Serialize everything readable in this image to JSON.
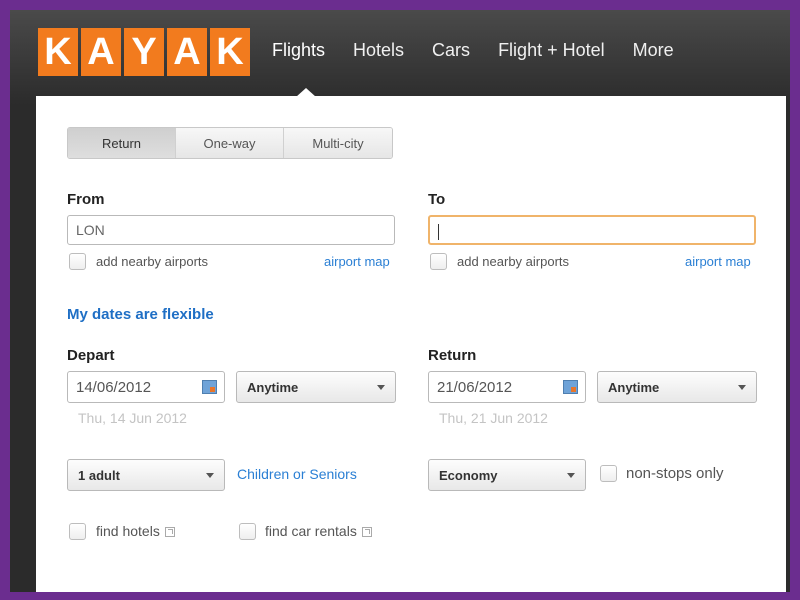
{
  "logo": {
    "letters": [
      "K",
      "A",
      "Y",
      "A",
      "K"
    ]
  },
  "nav": {
    "items": [
      "Flights",
      "Hotels",
      "Cars",
      "Flight + Hotel",
      "More"
    ],
    "active": "Flights"
  },
  "trip_type": {
    "options": [
      "Return",
      "One-way",
      "Multi-city"
    ],
    "selected": "Return"
  },
  "from": {
    "label": "From",
    "value": "LON",
    "nearby_label": "add nearby airports",
    "map_link": "airport map"
  },
  "to": {
    "label": "To",
    "value": "",
    "nearby_label": "add nearby airports",
    "map_link": "airport map"
  },
  "flexible_link": "My dates are flexible",
  "depart": {
    "label": "Depart",
    "date": "14/06/2012",
    "time": "Anytime",
    "hint": "Thu, 14 Jun 2012"
  },
  "return": {
    "label": "Return",
    "date": "21/06/2012",
    "time": "Anytime",
    "hint": "Thu, 21 Jun 2012"
  },
  "passengers": {
    "value": "1 adult",
    "link": "Children or Seniors"
  },
  "cabin": {
    "value": "Economy"
  },
  "nonstop": {
    "label": "non-stops only"
  },
  "extras": {
    "hotels": "find hotels",
    "cars": "find car rentals"
  },
  "colors": {
    "brand_orange": "#f27b1e",
    "link_blue": "#2a7fd4",
    "frame_purple": "#6b2d8f",
    "focus_orange": "#f0b46a"
  }
}
